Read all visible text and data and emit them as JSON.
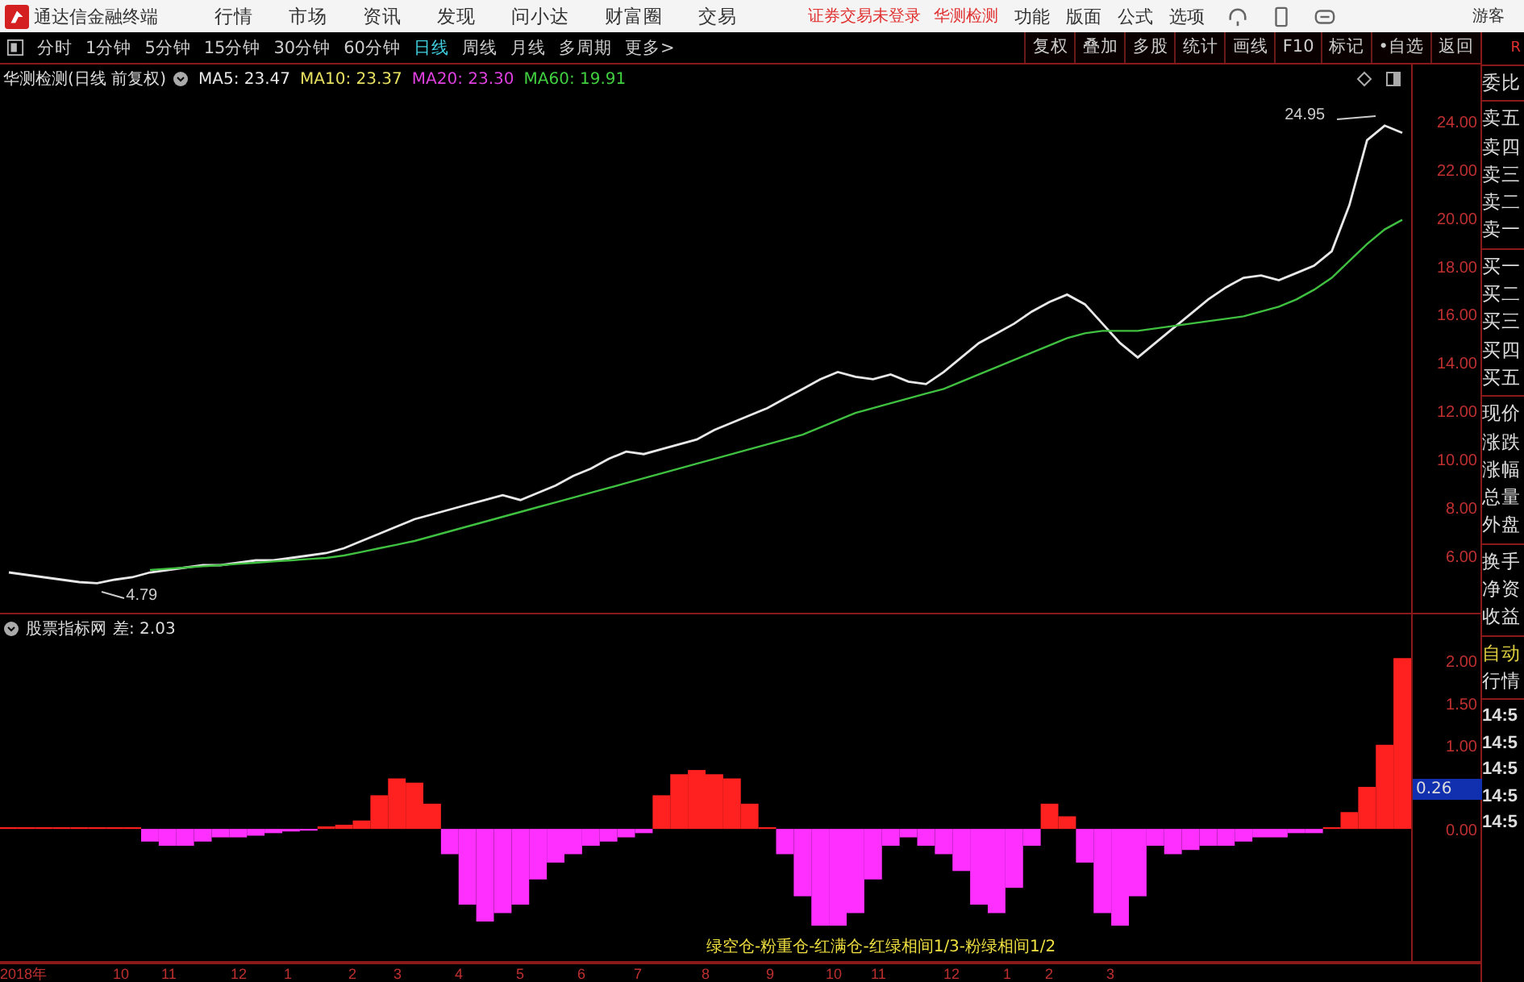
{
  "app": {
    "title": "通达信金融终端",
    "menu": [
      "行情",
      "市场",
      "资讯",
      "发现",
      "问小达",
      "财富圈",
      "交易"
    ],
    "login_status": "证券交易未登录",
    "stock_name": "华测检测",
    "tools": [
      "功能",
      "版面",
      "公式",
      "选项"
    ],
    "user": "游客"
  },
  "period_tabs": [
    {
      "label": "分时",
      "selected": false
    },
    {
      "label": "1分钟",
      "selected": false
    },
    {
      "label": "5分钟",
      "selected": false
    },
    {
      "label": "15分钟",
      "selected": false
    },
    {
      "label": "30分钟",
      "selected": false
    },
    {
      "label": "60分钟",
      "selected": false
    },
    {
      "label": "日线",
      "selected": true
    },
    {
      "label": "周线",
      "selected": false
    },
    {
      "label": "月线",
      "selected": false
    },
    {
      "label": "多周期",
      "selected": false
    },
    {
      "label": "更多>",
      "selected": false
    }
  ],
  "chart_buttons": [
    "复权",
    "叠加",
    "多股",
    "统计",
    "画线",
    "F10",
    "标记",
    "•自选",
    "返回"
  ],
  "price_panel": {
    "title": "华测检测(日线 前复权)",
    "ma_legend": [
      {
        "label": "MA5: 23.47",
        "color": "#e8e8e8"
      },
      {
        "label": "MA10: 23.37",
        "color": "#e8e060"
      },
      {
        "label": "MA20: 23.30",
        "color": "#e040e0"
      },
      {
        "label": "MA60: 19.91",
        "color": "#40d040"
      }
    ],
    "chart_data": {
      "type": "line",
      "ylim": [
        3.63,
        26.33
      ],
      "yticks": [
        {
          "value": 6,
          "label": "6.00"
        },
        {
          "value": 8,
          "label": "8.00"
        },
        {
          "value": 10,
          "label": "10.00"
        },
        {
          "value": 12,
          "label": "12.00"
        },
        {
          "value": 14,
          "label": "14.00"
        },
        {
          "value": 16,
          "label": "16.00"
        },
        {
          "value": 18,
          "label": "18.00"
        },
        {
          "value": 20,
          "label": "20.00"
        },
        {
          "value": 22,
          "label": "22.00"
        },
        {
          "value": 24,
          "label": "24.00"
        }
      ],
      "series": [
        {
          "color": "#e8e8e8",
          "values": [
            5.3,
            5.2,
            5.1,
            5.0,
            4.9,
            4.85,
            5.0,
            5.1,
            5.3,
            5.4,
            5.5,
            5.6,
            5.6,
            5.7,
            5.8,
            5.8,
            5.9,
            6.0,
            6.1,
            6.3,
            6.6,
            6.9,
            7.2,
            7.5,
            7.7,
            7.9,
            8.1,
            8.3,
            8.5,
            8.3,
            8.6,
            8.9,
            9.3,
            9.6,
            10.0,
            10.3,
            10.2,
            10.4,
            10.6,
            10.8,
            11.2,
            11.5,
            11.8,
            12.1,
            12.5,
            12.9,
            13.3,
            13.6,
            13.4,
            13.3,
            13.5,
            13.2,
            13.1,
            13.6,
            14.2,
            14.8,
            15.2,
            15.6,
            16.1,
            16.5,
            16.8,
            16.4,
            15.6,
            14.8,
            14.2,
            14.8,
            15.4,
            16.0,
            16.6,
            17.1,
            17.5,
            17.6,
            17.4,
            17.7,
            18.0,
            18.6,
            20.5,
            23.2,
            23.8,
            23.5
          ]
        },
        {
          "color": "#40c040",
          "values": [
            null,
            null,
            null,
            null,
            null,
            null,
            null,
            null,
            5.4,
            5.45,
            5.5,
            5.55,
            5.6,
            5.65,
            5.7,
            5.75,
            5.8,
            5.85,
            5.9,
            6.0,
            6.15,
            6.3,
            6.45,
            6.6,
            6.8,
            7.0,
            7.2,
            7.4,
            7.6,
            7.8,
            8.0,
            8.2,
            8.4,
            8.6,
            8.8,
            9.0,
            9.2,
            9.4,
            9.6,
            9.8,
            10.0,
            10.2,
            10.4,
            10.6,
            10.8,
            11.0,
            11.3,
            11.6,
            11.9,
            12.1,
            12.3,
            12.5,
            12.7,
            12.9,
            13.2,
            13.5,
            13.8,
            14.1,
            14.4,
            14.7,
            15.0,
            15.2,
            15.3,
            15.3,
            15.3,
            15.4,
            15.5,
            15.6,
            15.7,
            15.8,
            15.9,
            16.1,
            16.3,
            16.6,
            17.0,
            17.5,
            18.2,
            18.9,
            19.5,
            19.9
          ]
        }
      ],
      "annotations": [
        "24.95",
        "4.79"
      ]
    }
  },
  "indicator_panel": {
    "title": "股票指标网",
    "reading": "差: 2.03",
    "current_value": "0.26",
    "legend": "绿空仓-粉重仓-红满仓-红绿相间1/3-粉绿相间1/2",
    "chart_data": {
      "type": "bar",
      "ylim": [
        -1.57,
        2.55
      ],
      "yticks": [
        {
          "value": 0,
          "label": "0.00"
        },
        {
          "value": 1,
          "label": "1.00"
        },
        {
          "value": 1.5,
          "label": "1.50"
        },
        {
          "value": 2,
          "label": "2.00"
        }
      ],
      "series": [
        {
          "color": "#ff2020",
          "values": [
            0.02,
            0.02,
            0.02,
            0.02,
            0.02,
            0.02,
            0.02,
            0.02,
            null,
            null,
            null,
            null,
            null,
            null,
            null,
            null,
            null,
            null,
            0.03,
            0.05,
            0.1,
            0.4,
            0.6,
            0.55,
            0.3,
            null,
            null,
            null,
            null,
            null,
            null,
            null,
            null,
            null,
            null,
            null,
            null,
            0.4,
            0.65,
            0.7,
            0.65,
            0.6,
            0.3,
            0.02,
            null,
            null,
            null,
            null,
            null,
            null,
            null,
            null,
            null,
            null,
            null,
            null,
            null,
            null,
            null,
            0.3,
            0.15,
            null,
            null,
            null,
            null,
            null,
            null,
            null,
            null,
            null,
            null,
            null,
            null,
            null,
            null,
            0.02,
            0.2,
            0.5,
            1.0,
            2.03
          ]
        },
        {
          "color": "#ff30ff",
          "values": [
            null,
            null,
            null,
            null,
            null,
            null,
            null,
            null,
            -0.15,
            -0.2,
            -0.2,
            -0.15,
            -0.1,
            -0.1,
            -0.08,
            -0.05,
            -0.03,
            -0.02,
            null,
            null,
            null,
            null,
            null,
            null,
            null,
            -0.3,
            -0.9,
            -1.1,
            -1.0,
            -0.9,
            -0.6,
            -0.4,
            -0.3,
            -0.2,
            -0.15,
            -0.1,
            -0.05,
            null,
            null,
            null,
            null,
            null,
            null,
            null,
            -0.3,
            -0.8,
            -1.15,
            -1.15,
            -1.0,
            -0.6,
            -0.2,
            -0.1,
            -0.2,
            -0.3,
            -0.5,
            -0.9,
            -1.0,
            -0.7,
            -0.2,
            null,
            null,
            -0.4,
            -1.0,
            -1.15,
            -0.8,
            -0.2,
            -0.3,
            -0.25,
            -0.2,
            -0.2,
            -0.15,
            -0.1,
            -0.1,
            -0.05,
            -0.05,
            null,
            null,
            null,
            null,
            null
          ]
        }
      ]
    }
  },
  "time_axis": [
    "2018年",
    "10",
    "11",
    "12",
    "1",
    "2",
    "3",
    "4",
    "5",
    "6",
    "7",
    "8",
    "9",
    "10",
    "11",
    "12",
    "1",
    "2",
    "3"
  ],
  "quote_panel": {
    "badge": "R",
    "groups": [
      [
        "委比"
      ],
      [
        "卖五",
        "卖四",
        "卖三",
        "卖二",
        "卖一"
      ],
      [
        "买一",
        "买二",
        "买三",
        "买四",
        "买五"
      ],
      [
        "现价",
        "涨跌",
        "涨幅",
        "总量",
        "外盘"
      ],
      [
        "换手",
        "净资",
        "收益"
      ]
    ],
    "tabs": [
      "自动",
      "行情"
    ],
    "ticks": [
      "14:5",
      "14:5",
      "14:5",
      "14:5",
      "14:5"
    ]
  }
}
